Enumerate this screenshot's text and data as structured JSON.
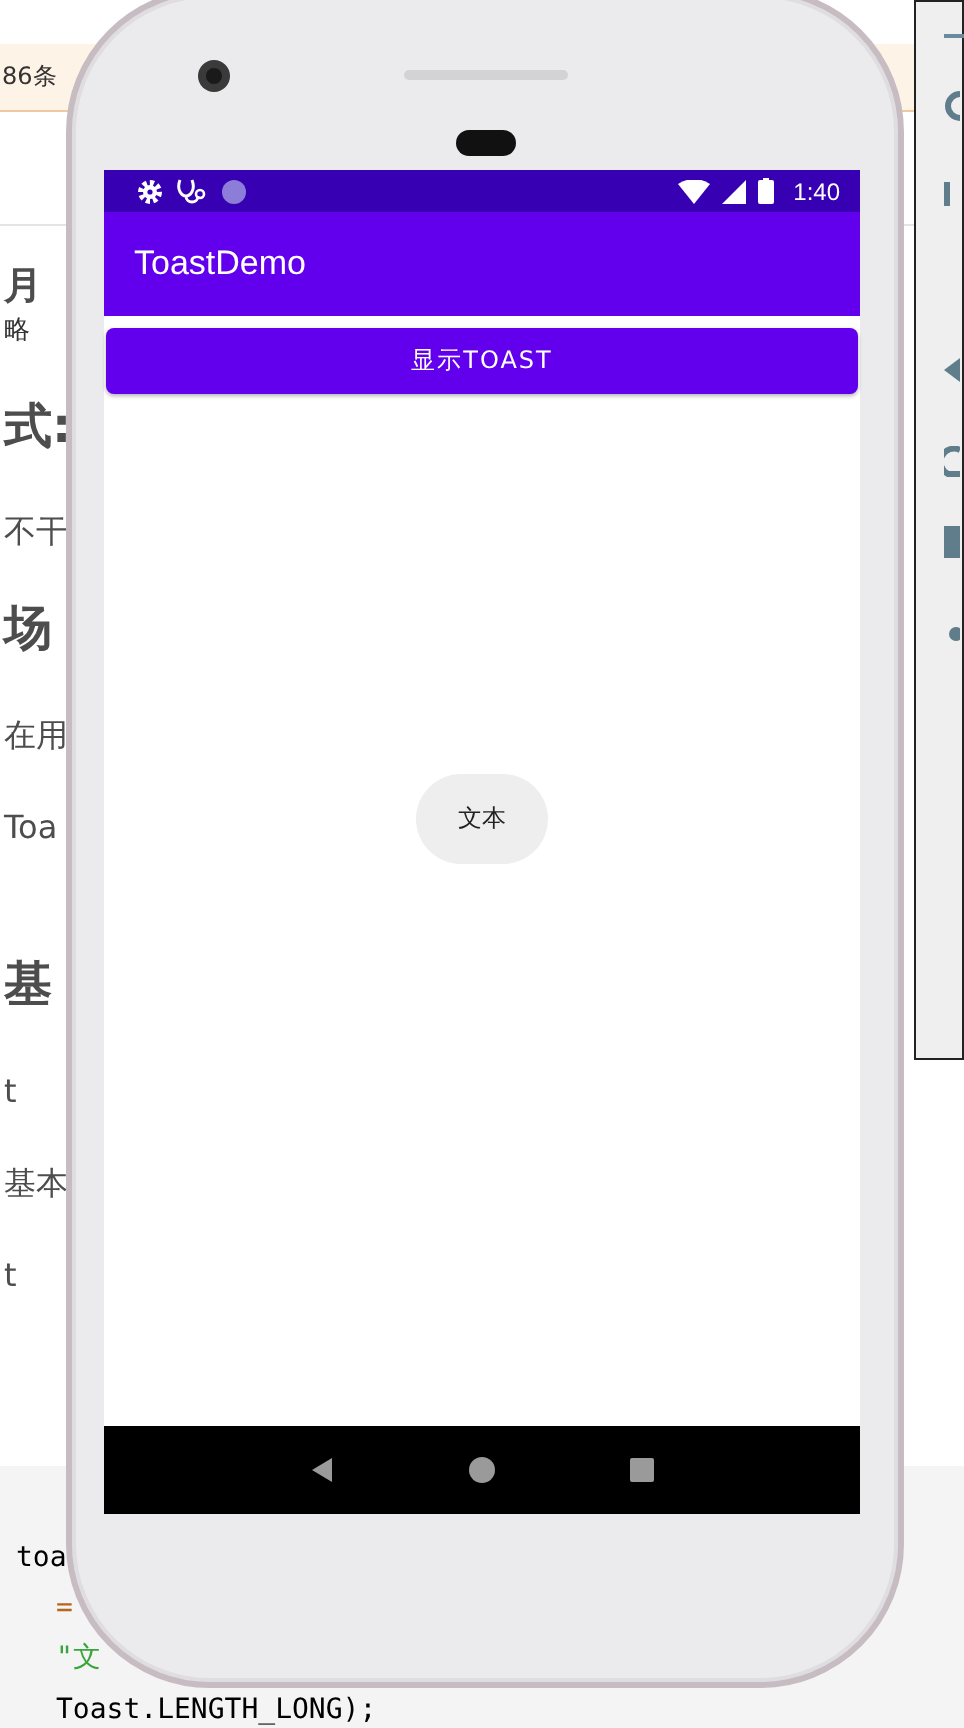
{
  "background_page": {
    "banner": "86条",
    "lines": [
      {
        "kind": "title",
        "text": "月"
      },
      {
        "kind": "caption",
        "text": "略"
      },
      {
        "kind": "heading",
        "text": "式:"
      },
      {
        "kind": "text",
        "text": "不干"
      },
      {
        "kind": "heading",
        "text": "场"
      },
      {
        "kind": "text",
        "text": "在用"
      },
      {
        "kind": "text",
        "text": "Toa"
      },
      {
        "kind": "heading-spaced",
        "text": "基"
      },
      {
        "kind": "text",
        "text": "t"
      },
      {
        "kind": "text",
        "text": "基本"
      },
      {
        "kind": "text",
        "text": "t"
      }
    ],
    "code": [
      {
        "kind": "plain",
        "text": "toa"
      },
      {
        "kind": "operator",
        "text": "="
      },
      {
        "kind": "string",
        "text": "\"文"
      },
      {
        "kind": "plain",
        "text": "Toast.LENGTH_LONG);"
      }
    ]
  },
  "phone": {
    "status_bar": {
      "time": "1:40"
    },
    "app_bar": {
      "title": "ToastDemo"
    },
    "button": {
      "label": "显示TOAST"
    },
    "toast": {
      "text": "文本"
    }
  }
}
